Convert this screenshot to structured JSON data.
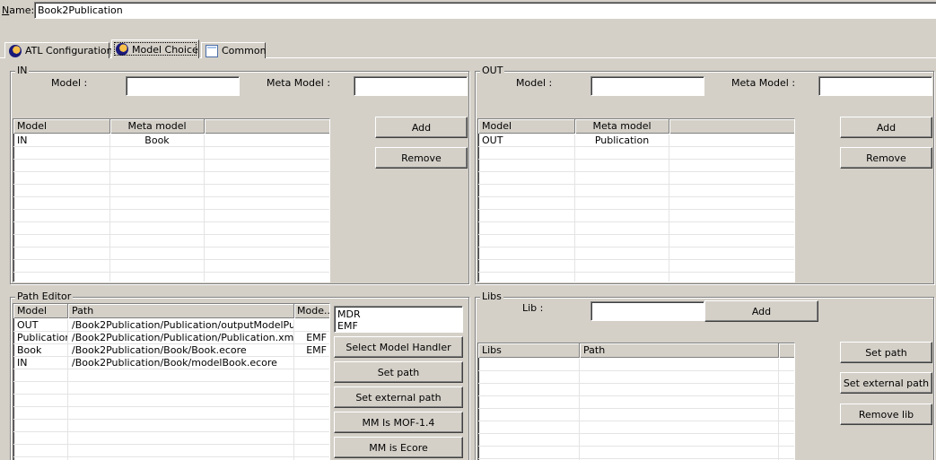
{
  "name_field": {
    "label": "Name:",
    "value": "Book2Publication"
  },
  "tabs": [
    {
      "label": "ATL Configuration",
      "icon": "atl-icon"
    },
    {
      "label": "Model Choice",
      "icon": "atl-icon",
      "selected": true
    },
    {
      "label": "Common",
      "icon": "window-icon"
    }
  ],
  "in_panel": {
    "title": "IN",
    "model_label": "Model :",
    "model_value": "",
    "meta_model_label": "Meta Model :",
    "meta_model_value": "",
    "columns": [
      "Model",
      "Meta model",
      ""
    ],
    "rows": [
      [
        "IN",
        "Book",
        ""
      ]
    ],
    "add_label": "Add",
    "remove_label": "Remove"
  },
  "out_panel": {
    "title": "OUT",
    "model_label": "Model :",
    "model_value": "",
    "meta_model_label": "Meta Model :",
    "meta_model_value": "",
    "columns": [
      "Model",
      "Meta model",
      ""
    ],
    "rows": [
      [
        "OUT",
        "Publication",
        ""
      ]
    ],
    "add_label": "Add",
    "remove_label": "Remove"
  },
  "path_editor": {
    "title": "Path Editor",
    "columns": [
      "Model",
      "Path",
      "Mode.."
    ],
    "rows": [
      [
        "OUT",
        "/Book2Publication/Publication/outputModelPubli...",
        ""
      ],
      [
        "Publication",
        "/Book2Publication/Publication/Publication.xmi",
        "EMF"
      ],
      [
        "Book",
        "/Book2Publication/Book/Book.ecore",
        "EMF"
      ],
      [
        "IN",
        "/Book2Publication/Book/modelBook.ecore",
        ""
      ]
    ],
    "handlers": [
      "MDR",
      "EMF"
    ],
    "buttons": {
      "select_handler": "Select Model Handler",
      "set_path": "Set path",
      "set_external_path": "Set external path",
      "mm_mof": "MM Is MOF-1.4",
      "mm_ecore": "MM is Ecore"
    }
  },
  "libs": {
    "title": "Libs",
    "lib_label": "Lib :",
    "lib_value": "",
    "add_label": "Add",
    "columns": [
      "Libs",
      "Path",
      ""
    ],
    "rows": [],
    "set_path": "Set path",
    "set_external_path": "Set external path",
    "remove_lib": "Remove lib"
  }
}
